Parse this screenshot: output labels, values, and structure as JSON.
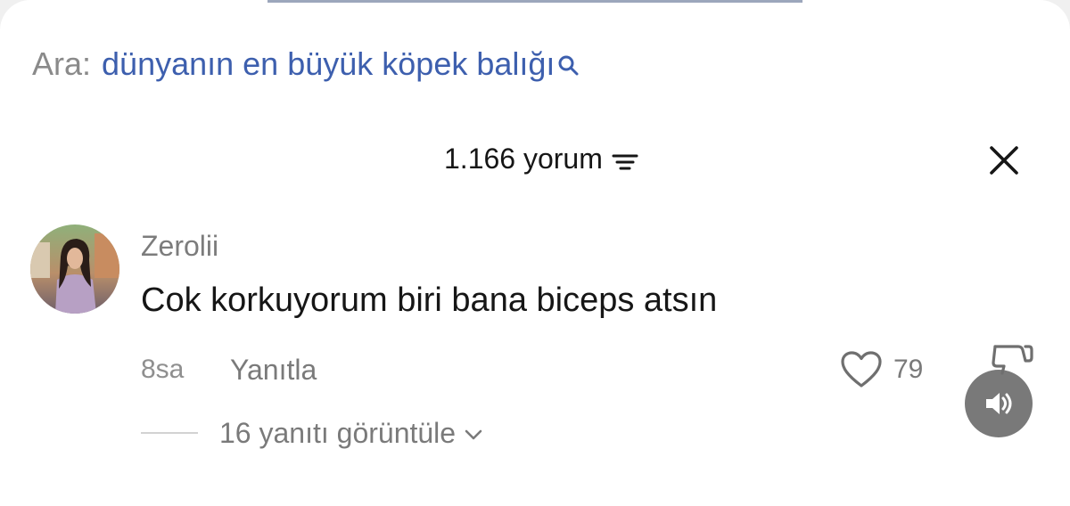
{
  "search": {
    "prefix": "Ara:",
    "query": "dünyanın en büyük köpek balığı",
    "icon": "search-icon",
    "color": "#3d5fae"
  },
  "header": {
    "comment_count_label": "1.166 yorum",
    "filter_icon": "filter-icon",
    "close_icon": "close-icon"
  },
  "comment": {
    "username": "Zerolii",
    "text": "Cok korkuyorum biri bana biceps atsın",
    "time": "8sa",
    "reply_label": "Yanıtla",
    "likes": "79",
    "like_icon": "heart-icon",
    "dislike_icon": "dislike-icon",
    "view_replies_label": "16 yanıtı görüntüle",
    "chevron_icon": "chevron-down-icon"
  },
  "overlay": {
    "sound_icon": "speaker-icon"
  }
}
